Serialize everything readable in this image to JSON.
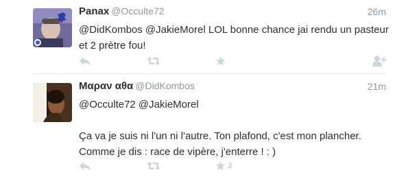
{
  "tweets": [
    {
      "fullname": "Panax",
      "username": "@Occulte72",
      "time": "26m",
      "text_lines": [
        "@DidKombos @JakieMorel LOL bonne chance jai rendu un pasteur et 2 prètre fou!"
      ],
      "favorite_count": ""
    },
    {
      "fullname": "Μαραν αθα",
      "username": "@DidKombos",
      "time": "21m",
      "text_lines": [
        "@Occulte72 @JakieMorel",
        "Ça va je suis ni l'un ni l'autre. Ton plafond, c'est mon plancher. Comme je dis : race de vipère, j'enterre ! : )"
      ],
      "favorite_count": "3"
    }
  ],
  "icons": {
    "reply": "reply-icon",
    "retweet": "retweet-icon",
    "favorite": "star-icon",
    "follow": "follow-user-icon"
  },
  "colors": {
    "icon": "#ccd6dd",
    "muted_text": "#8899a6",
    "main_text": "#292f33"
  }
}
